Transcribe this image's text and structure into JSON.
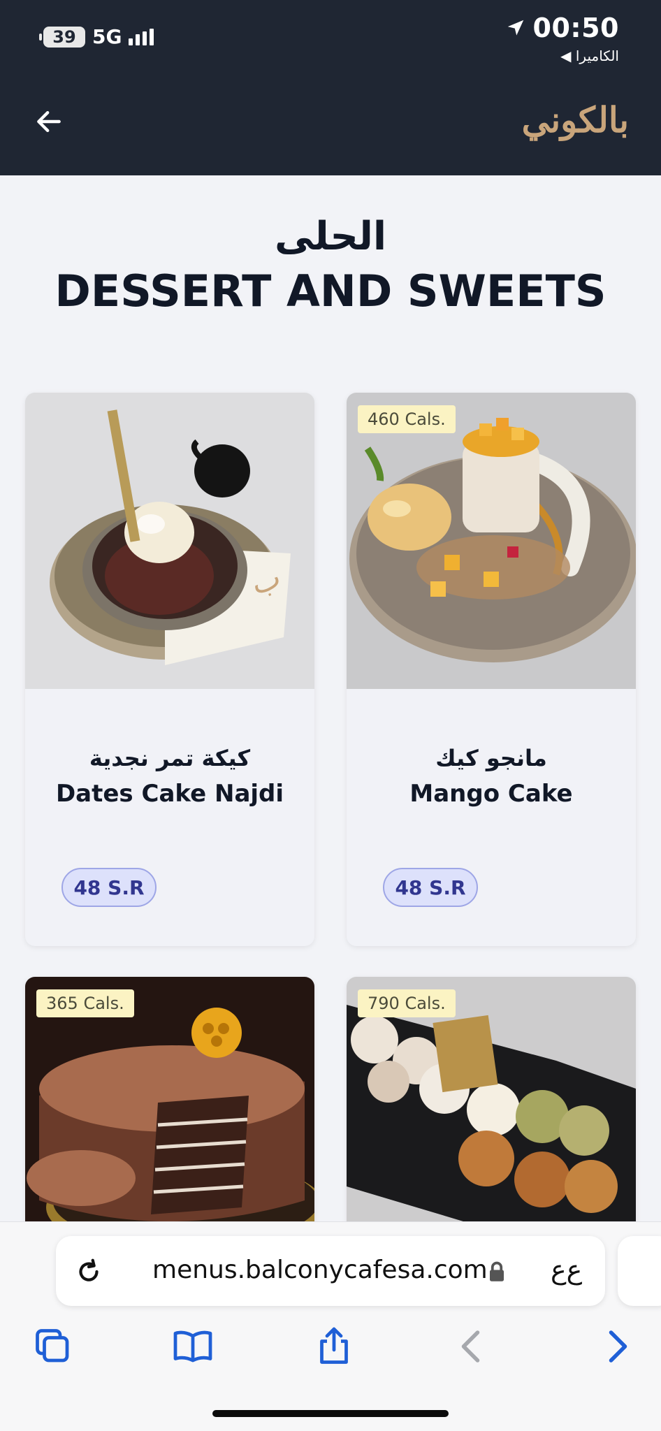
{
  "status_bar": {
    "battery": "39",
    "network": "5G",
    "time": "00:50",
    "back_app": "◀ الكاميرا"
  },
  "header": {
    "logo_text": "بالكوني",
    "back_icon": "arrow-left-icon"
  },
  "page": {
    "title_ar": "الحلى",
    "title_en": "DESSERT AND SWEETS"
  },
  "menu_items": [
    {
      "name_ar": "كيكة تمر نجدية",
      "name_en": "Dates Cake Najdi",
      "price": "48 S.R",
      "calories": ""
    },
    {
      "name_ar": "مانجو كيك",
      "name_en": "Mango Cake",
      "price": "48 S.R",
      "calories": "460 Cals."
    },
    {
      "name_ar": "",
      "name_en": "",
      "price": "",
      "calories": "365 Cals."
    },
    {
      "name_ar": "",
      "name_en": "",
      "price": "",
      "calories": "790 Cals."
    }
  ],
  "browser": {
    "url": "menus.balconycafesa.com",
    "text_size_button": "ع‌ع",
    "toolbar_icons": [
      "tabs-icon",
      "bookmarks-icon",
      "share-icon",
      "back-icon",
      "forward-icon"
    ]
  },
  "colors": {
    "header_bg": "#1f2633",
    "logo_gold": "#c9a57b",
    "price_text": "#31368f",
    "price_bg": "#dde1fb",
    "calorie_badge": "#fbf3c3",
    "toolbar_blue": "#1f5fd6"
  }
}
